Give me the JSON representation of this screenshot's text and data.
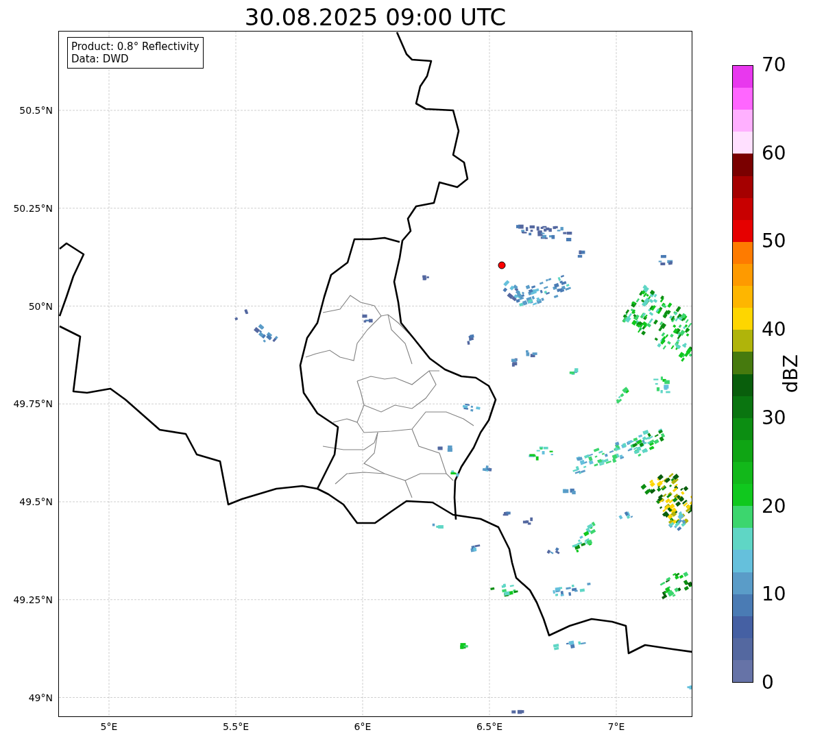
{
  "title": "30.08.2025 09:00 UTC",
  "info_box": {
    "lines": [
      "Product: 0.8° Reflectivity",
      "Data: DWD"
    ]
  },
  "map": {
    "lat_ticks": [
      "50.5°N",
      "50.25°N",
      "50°N",
      "49.75°N",
      "49.5°N",
      "49.25°N",
      "49°N"
    ],
    "lon_ticks": [
      "5°E",
      "5.5°E",
      "6°E",
      "6.5°E",
      "7°E"
    ]
  },
  "colorbar": {
    "label": "dBZ",
    "ticks": [
      "70",
      "60",
      "50",
      "40",
      "30",
      "20",
      "10",
      "0"
    ],
    "bands": [
      {
        "color": "#e838ee"
      },
      {
        "color": "#ff66ff"
      },
      {
        "color": "#ffb0ff"
      },
      {
        "color": "#ffe0ff"
      },
      {
        "color": "#7a0000"
      },
      {
        "color": "#a50000"
      },
      {
        "color": "#c80000"
      },
      {
        "color": "#e60000"
      },
      {
        "color": "#fe7b00"
      },
      {
        "color": "#fe9a00"
      },
      {
        "color": "#feb600"
      },
      {
        "color": "#fed600"
      },
      {
        "color": "#b0b40a"
      },
      {
        "color": "#467a0e"
      },
      {
        "color": "#095e0c"
      },
      {
        "color": "#0a7510"
      },
      {
        "color": "#0c8e12"
      },
      {
        "color": "#0fa514"
      },
      {
        "color": "#12b81a"
      },
      {
        "color": "#10c81e"
      },
      {
        "color": "#3cd66e"
      },
      {
        "color": "#5fd6c5"
      },
      {
        "color": "#65c0dc"
      },
      {
        "color": "#5a9cc8"
      },
      {
        "color": "#4a7bb4"
      },
      {
        "color": "#4560a3"
      },
      {
        "color": "#5468a0"
      },
      {
        "color": "#6673a7"
      }
    ]
  }
}
